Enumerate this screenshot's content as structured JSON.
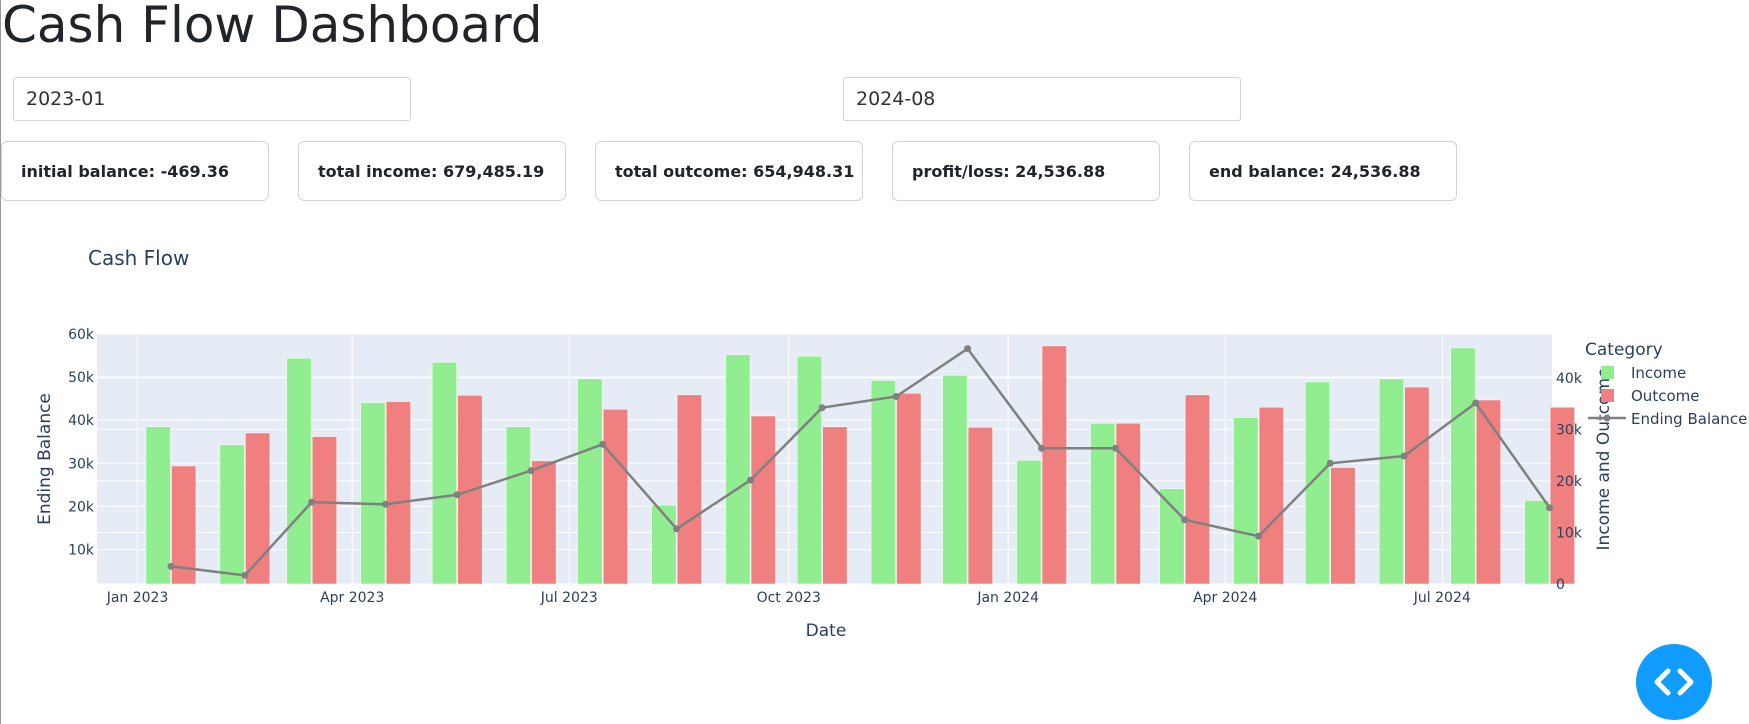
{
  "title": "Cash Flow Dashboard",
  "date_range": {
    "start": "2023-01",
    "end": "2024-08"
  },
  "kpis": [
    {
      "label": "initial balance: -469.36"
    },
    {
      "label": "total income: 679,485.19"
    },
    {
      "label": "total outcome: 654,948.31"
    },
    {
      "label": "profit/loss: 24,536.88"
    },
    {
      "label": "end balance: 24,536.88"
    }
  ],
  "colors": {
    "income": "#90ee90",
    "outcome": "#f08080",
    "balance": "#808080",
    "plot_bg": "#e5ecf6",
    "axis_text": "#2a3f5f",
    "fab": "#119dff"
  },
  "fab_icon": "code-icon",
  "chart_data": {
    "type": "bar",
    "title": "Cash Flow",
    "xlabel": "Date",
    "ylabel": "Ending Balance",
    "y2label": "Income and Outcome",
    "legend_title": "Category",
    "legend_position": "top-right",
    "grid": true,
    "xticks": [
      "Jan 2023",
      "Apr 2023",
      "Jul 2023",
      "Oct 2023",
      "Jan 2024",
      "Apr 2024",
      "Jul 2024"
    ],
    "yticks": [
      "10k",
      "20k",
      "30k",
      "40k",
      "50k",
      "60k"
    ],
    "y2ticks": [
      "0",
      "10k",
      "20k",
      "30k",
      "40k"
    ],
    "ylim": [
      2000,
      60000
    ],
    "y2lim": [
      0,
      48500
    ],
    "months": [
      "2023-01",
      "2023-02",
      "2023-03",
      "2023-04",
      "2023-05",
      "2023-06",
      "2023-07",
      "2023-08",
      "2023-09",
      "2023-10",
      "2023-11",
      "2023-12",
      "2024-01",
      "2024-02",
      "2024-03",
      "2024-04",
      "2024-05",
      "2024-06",
      "2024-07",
      "2024-08"
    ],
    "series": [
      {
        "name": "Income",
        "axis": "y2",
        "values": [
          30500,
          27000,
          43800,
          35200,
          43000,
          30500,
          39800,
          15300,
          44500,
          44200,
          39500,
          40500,
          24000,
          31200,
          18500,
          32300,
          39200,
          39800,
          45800,
          16200
        ]
      },
      {
        "name": "Outcome",
        "axis": "y2",
        "values": [
          22900,
          29300,
          28600,
          35400,
          36600,
          23900,
          33900,
          36700,
          32600,
          30500,
          37000,
          30400,
          46200,
          31200,
          36700,
          34300,
          22600,
          38200,
          35700,
          34300
        ]
      },
      {
        "name": "Ending Balance",
        "axis": "y",
        "values": [
          6100,
          4000,
          21000,
          20500,
          22700,
          28300,
          34400,
          14800,
          26100,
          42900,
          45500,
          56600,
          33500,
          33500,
          16900,
          13100,
          30000,
          31700,
          44000,
          19700
        ]
      }
    ]
  }
}
